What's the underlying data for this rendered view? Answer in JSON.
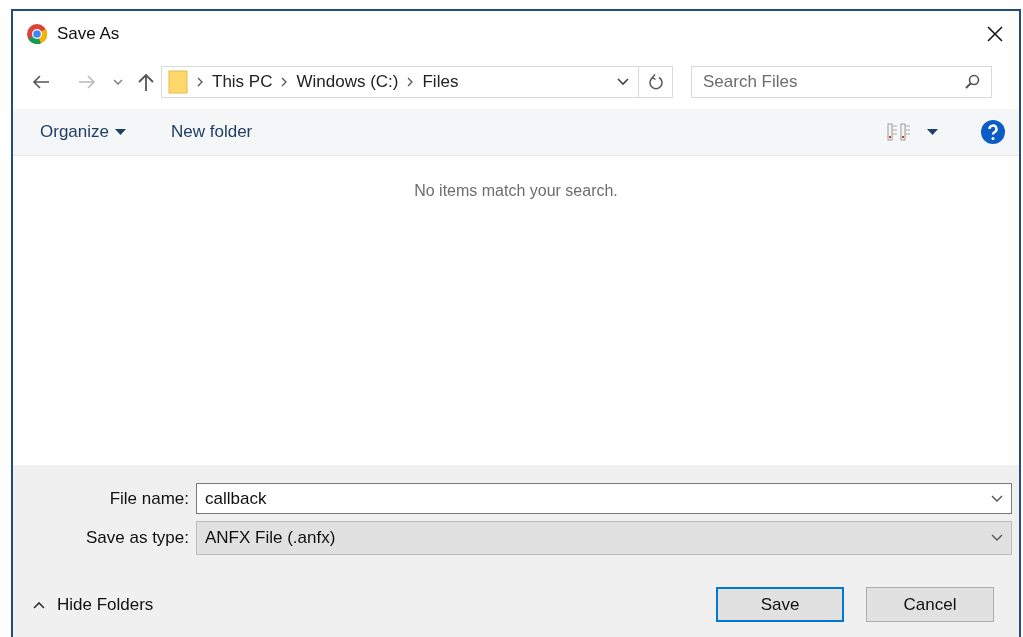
{
  "window": {
    "title": "Save As"
  },
  "breadcrumb": [
    "This PC",
    "Windows (C:)",
    "Files"
  ],
  "search": {
    "placeholder": "Search Files"
  },
  "toolbar": {
    "organize": "Organize",
    "new_folder": "New folder"
  },
  "content": {
    "message": "No items match your search."
  },
  "fields": [
    {
      "label": "File name:",
      "value": "callback",
      "kind": "input"
    },
    {
      "label": "Save as type:",
      "value": "ANFX File (.anfx)",
      "kind": "select"
    }
  ],
  "hide_folders": "Hide Folders",
  "buttons": [
    {
      "label": "Save",
      "default": true
    },
    {
      "label": "Cancel",
      "default": false
    }
  ]
}
